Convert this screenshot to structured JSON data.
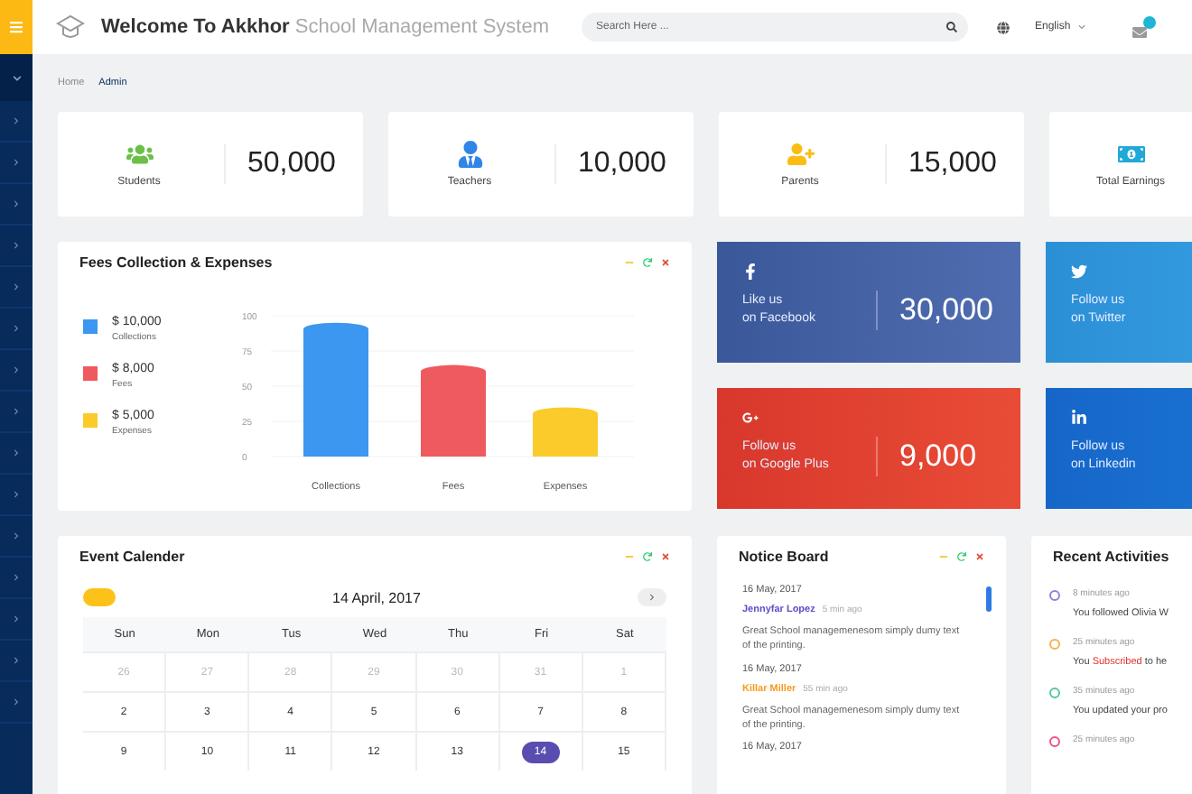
{
  "header": {
    "title_bold": "Welcome To Akkhor",
    "title_light": "School Management System",
    "search": {
      "placeholder": "Search Here ..."
    },
    "language": "English"
  },
  "breadcrumb": [
    {
      "label": "Home",
      "selected": false
    },
    {
      "label": "Admin",
      "selected": true
    }
  ],
  "stats": [
    {
      "kind": "students",
      "label": "Students",
      "value": "50,000"
    },
    {
      "kind": "teachers",
      "label": "Teachers",
      "value": "10,000"
    },
    {
      "kind": "parents",
      "label": "Parents",
      "value": "15,000"
    },
    {
      "kind": "earnings",
      "label": "Total Earnings"
    }
  ],
  "fees_chart": {
    "title": "Fees Collection & Expenses",
    "legend": [
      {
        "amount": "$ 10,000",
        "label": "Collections",
        "color": "#3b97ef"
      },
      {
        "amount": "$ 8,000",
        "label": "Fees",
        "color": "#ef5a5f"
      },
      {
        "amount": "$ 5,000",
        "label": "Expenses",
        "color": "#fbcb2c"
      }
    ],
    "chart_data": {
      "type": "bar",
      "categories": [
        "Collections",
        "Fees",
        "Expenses"
      ],
      "values": [
        95,
        65,
        35
      ],
      "ylim": [
        0,
        100
      ],
      "grid": true,
      "yticks": [
        0,
        25,
        50,
        75,
        100
      ]
    }
  },
  "social": [
    {
      "kind": "facebook",
      "line1": "Like us",
      "line2": "on Facebook",
      "count": "30,000"
    },
    {
      "kind": "twitter",
      "line1": "Follow us",
      "line2": "on Twitter"
    },
    {
      "kind": "google-plus",
      "line1": "Follow us",
      "line2": "on Google Plus",
      "count": "9,000"
    },
    {
      "kind": "linkedin",
      "line1": "Follow us",
      "line2": "on Linkedin"
    }
  ],
  "calendar": {
    "title": "Event Calender",
    "month": "14 April, 2017",
    "weekdays": [
      "Sun",
      "Mon",
      "Tus",
      "Wed",
      "Thu",
      "Fri",
      "Sat"
    ],
    "weeks": [
      [
        {
          "day": "26",
          "muted": true,
          "selected": false
        },
        {
          "day": "27",
          "muted": true,
          "selected": false
        },
        {
          "day": "28",
          "muted": true,
          "selected": false
        },
        {
          "day": "29",
          "muted": true,
          "selected": false
        },
        {
          "day": "30",
          "muted": true,
          "selected": false
        },
        {
          "day": "31",
          "muted": true,
          "selected": false
        },
        {
          "day": "1",
          "muted": true,
          "selected": false
        }
      ],
      [
        {
          "day": "2",
          "muted": false,
          "selected": false
        },
        {
          "day": "3",
          "muted": false,
          "selected": false
        },
        {
          "day": "4",
          "muted": false,
          "selected": false
        },
        {
          "day": "5",
          "muted": false,
          "selected": false
        },
        {
          "day": "6",
          "muted": false,
          "selected": false
        },
        {
          "day": "7",
          "muted": false,
          "selected": false
        },
        {
          "day": "8",
          "muted": false,
          "selected": false
        }
      ],
      [
        {
          "day": "9",
          "muted": false,
          "selected": false
        },
        {
          "day": "10",
          "muted": false,
          "selected": false
        },
        {
          "day": "11",
          "muted": false,
          "selected": false
        },
        {
          "day": "12",
          "muted": false,
          "selected": false
        },
        {
          "day": "13",
          "muted": false,
          "selected": false
        },
        {
          "day": "14",
          "muted": false,
          "selected": true
        },
        {
          "day": "15",
          "muted": false,
          "selected": false
        }
      ]
    ]
  },
  "notice_board": {
    "title": "Notice Board",
    "notices": [
      {
        "date": "16 May, 2017",
        "author": "Jennyfar Lopez",
        "color": "#5b4fc8",
        "time": "5 min ago",
        "text": "Great School managemenesom simply dumy text of the printing."
      },
      {
        "date": "16 May, 2017",
        "author": "Killar Miller",
        "color": "#f79a1e",
        "time": "55 min ago",
        "text": "Great School managemenesom simply dumy text of the printing."
      },
      {
        "date": "16 May, 2017"
      }
    ]
  },
  "recent_activities": {
    "title": "Recent Activities",
    "items": [
      {
        "color": "#8c83e0",
        "time": "8 minutes ago",
        "parts": [
          {
            "text": "You followed Olivia W",
            "highlight": false
          }
        ]
      },
      {
        "color": "#f7b34a",
        "time": "25 minutes ago",
        "parts": [
          {
            "text": "You",
            "highlight": false
          },
          {
            "text": "Subscribed",
            "highlight": true
          },
          {
            "text": "to he",
            "highlight": false
          }
        ]
      },
      {
        "color": "#55c69d",
        "time": "35 minutes ago",
        "parts": [
          {
            "text": "You updated your pro",
            "highlight": false
          }
        ]
      },
      {
        "color": "#f0508a",
        "time": "25 minutes ago"
      }
    ]
  }
}
